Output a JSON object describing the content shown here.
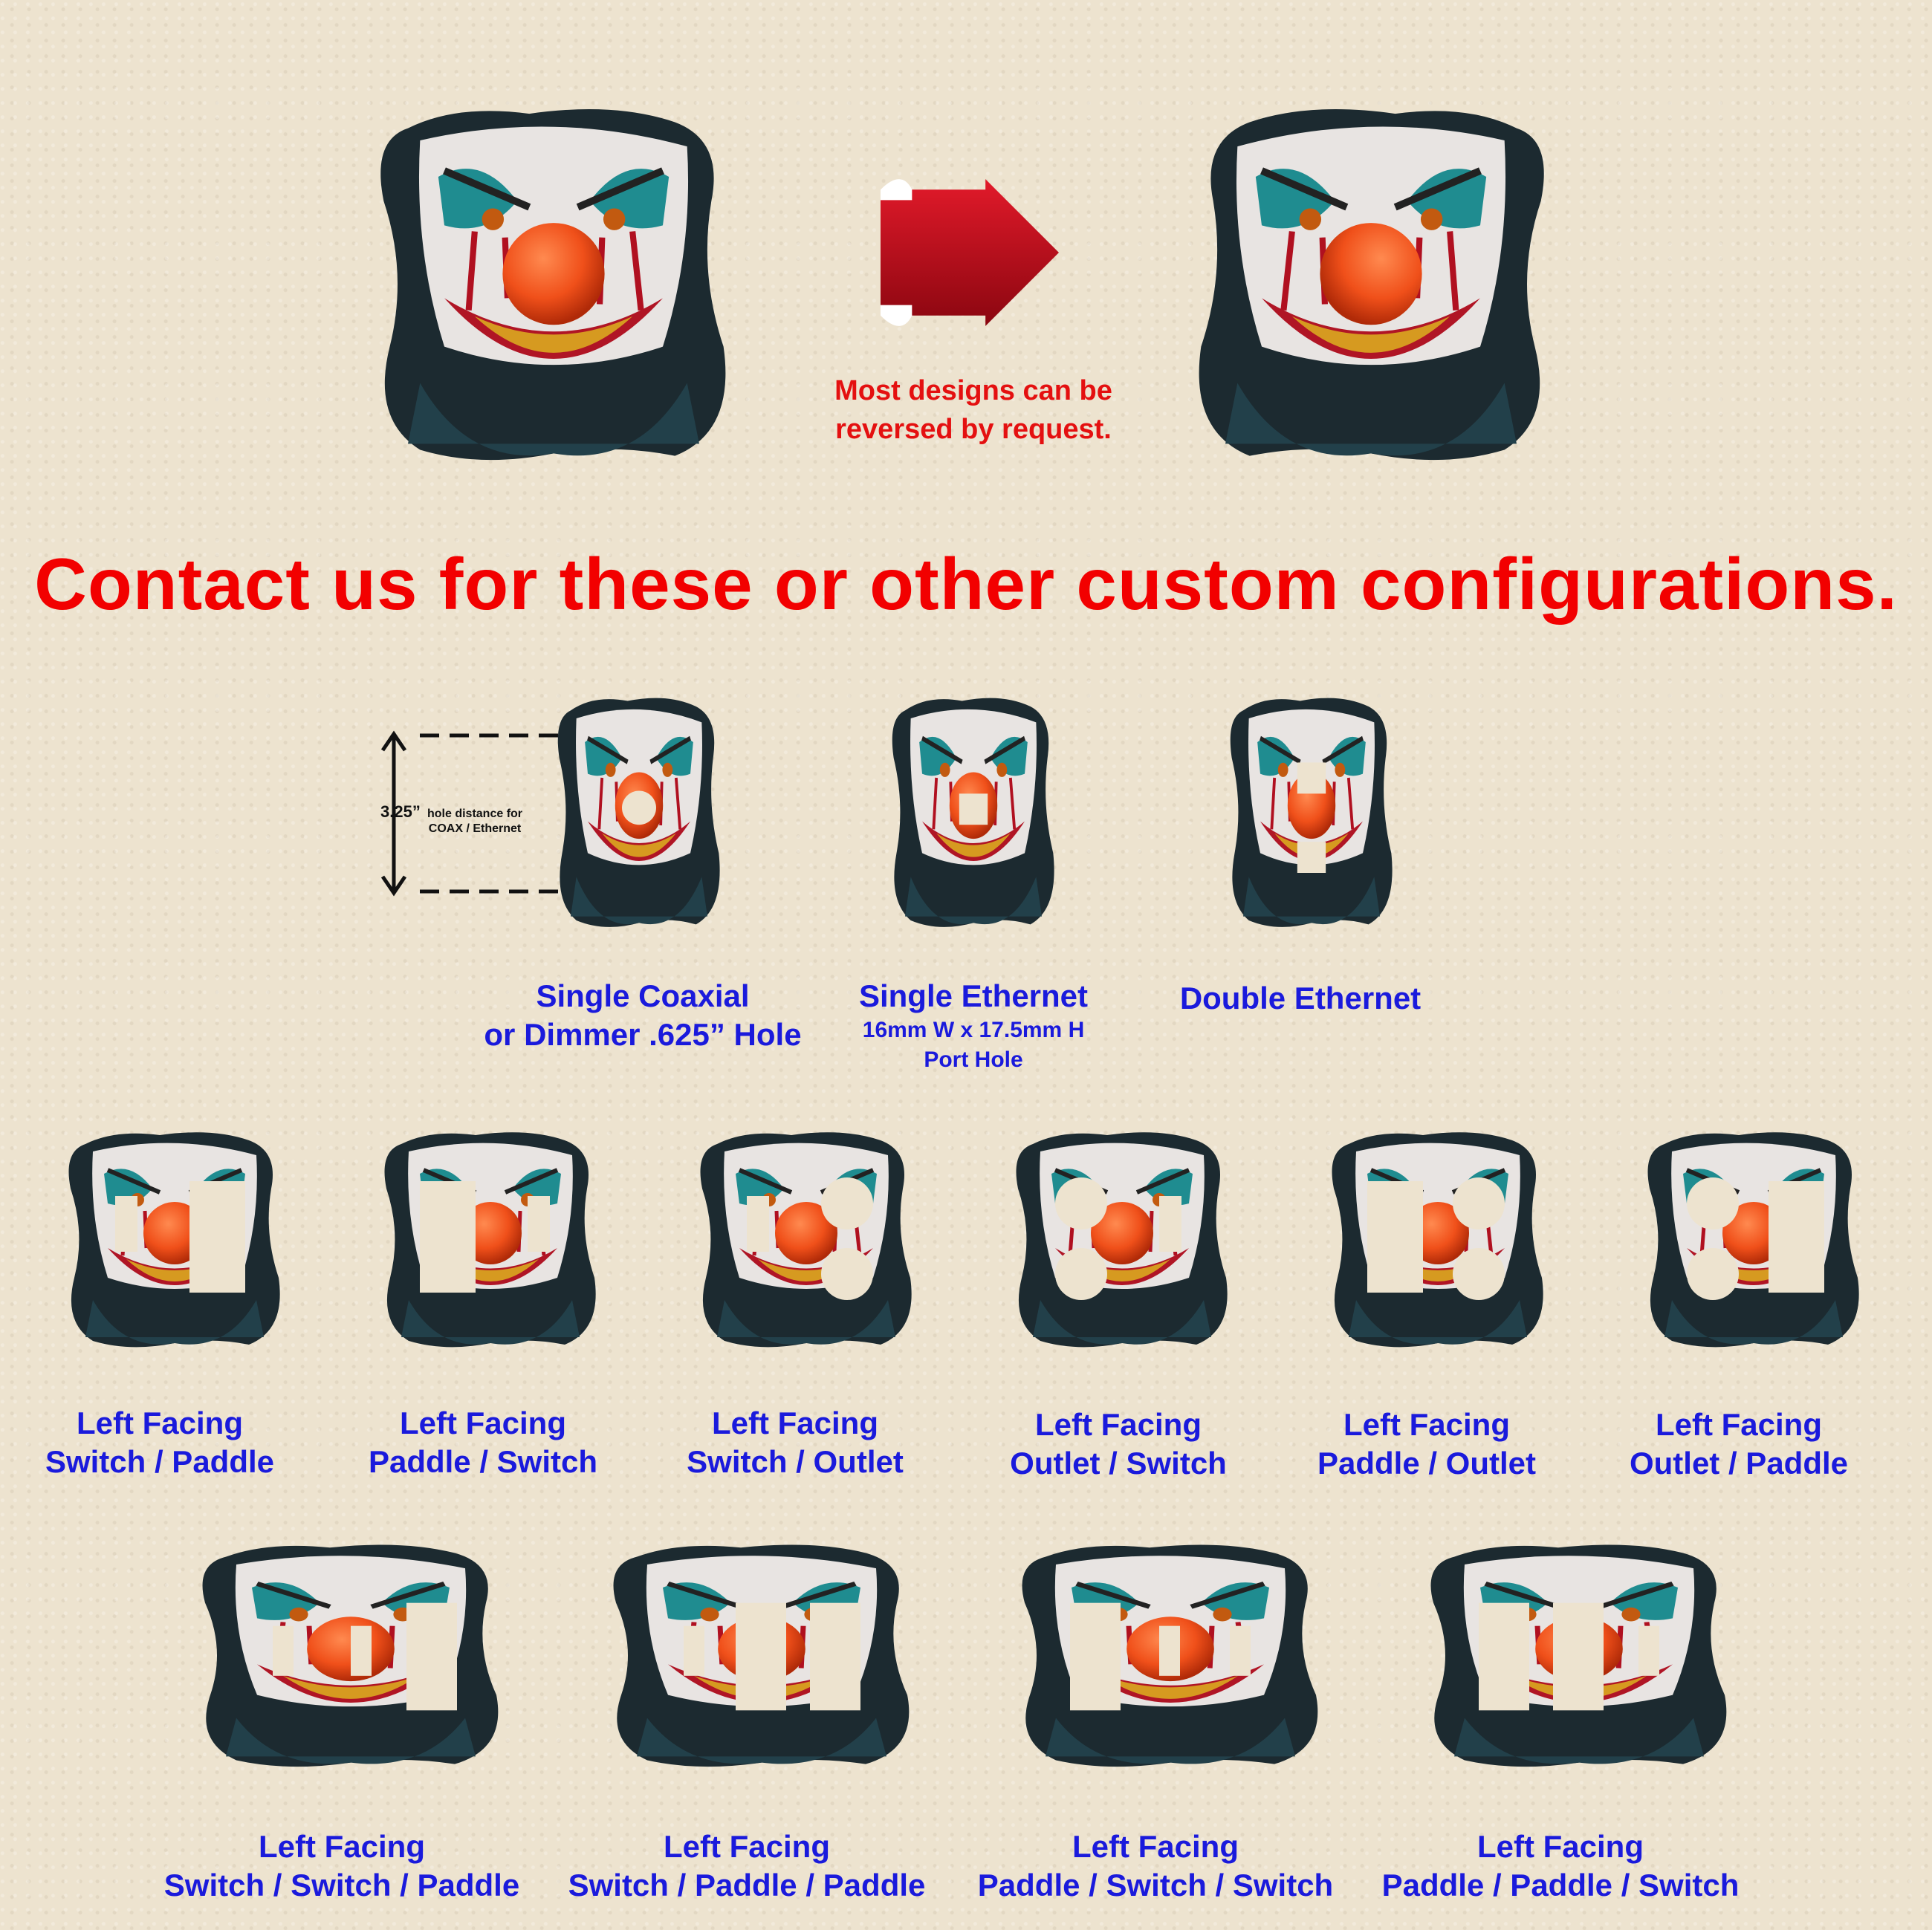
{
  "reverse_note": {
    "line1": "Most designs can be",
    "line2": "reversed by request."
  },
  "headline": "Contact us for these or other custom configurations.",
  "dimension": {
    "value": "3.25”",
    "desc_line1": "hole distance for",
    "desc_line2": "COAX / Ethernet"
  },
  "row1": [
    {
      "line1": "Single Coaxial",
      "line2": "or Dimmer .625” Hole"
    },
    {
      "line1": "Single Ethernet",
      "line2": "16mm W x 17.5mm H",
      "line3": "Port Hole"
    },
    {
      "line1": "Double Ethernet"
    }
  ],
  "row2": [
    {
      "line1": "Left Facing",
      "line2": "Switch / Paddle"
    },
    {
      "line1": "Left Facing",
      "line2": "Paddle / Switch"
    },
    {
      "line1": "Left Facing",
      "line2": "Switch / Outlet"
    },
    {
      "line1": "Left Facing",
      "line2": "Outlet / Switch"
    },
    {
      "line1": "Left Facing",
      "line2": "Paddle / Outlet"
    },
    {
      "line1": "Left Facing",
      "line2": "Outlet / Paddle"
    }
  ],
  "row3": [
    {
      "line1": "Left Facing",
      "line2": "Switch / Switch / Paddle"
    },
    {
      "line1": "Left Facing",
      "line2": "Switch / Paddle / Paddle"
    },
    {
      "line1": "Left Facing",
      "line2": "Paddle / Switch / Switch"
    },
    {
      "line1": "Left Facing",
      "line2": "Paddle / Paddle / Switch"
    }
  ],
  "colors": {
    "headline": "#f20000",
    "captions": "#1a1adc",
    "arrow": "#c0101a",
    "background": "#ede3cf"
  }
}
